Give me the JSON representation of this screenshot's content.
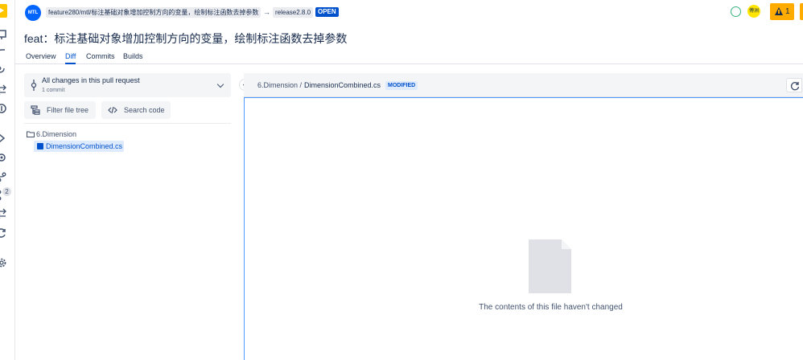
{
  "topbar": {
    "repo_avatar_text": "MTL",
    "source_branch": "feature280/mtl/标注基础对象增加控制方向的变量，绘制标注函数去掉参数",
    "arrow": "→",
    "target_branch": "release2.8.0",
    "status": "OPEN",
    "user_avatar_text": "傅洲",
    "warning_count": "1"
  },
  "pr": {
    "title": "feat：标注基础对象增加控制方向的变量，绘制标注函数去掉参数"
  },
  "tabs": [
    {
      "label": "Overview"
    },
    {
      "label": "Diff"
    },
    {
      "label": "Commits"
    },
    {
      "label": "Builds"
    }
  ],
  "rail": {
    "badge_count": "2"
  },
  "sidebar": {
    "changes_title": "All changes in this pull request",
    "changes_subtitle": "1 commit",
    "filter_label": "Filter file tree",
    "search_label": "Search code",
    "tree": {
      "folder": "6.Dimension",
      "file": "DimensionCombined.cs"
    }
  },
  "file": {
    "dir": "6.Dimension /",
    "name": "DimensionCombined.cs",
    "status": "MODIFIED",
    "empty_message": "The contents of this file haven't changed"
  },
  "colors": {
    "accent": "#0052cc",
    "open_badge": "#0052cc",
    "warning": "#ffab00",
    "panel_bg": "#f4f5f7"
  }
}
